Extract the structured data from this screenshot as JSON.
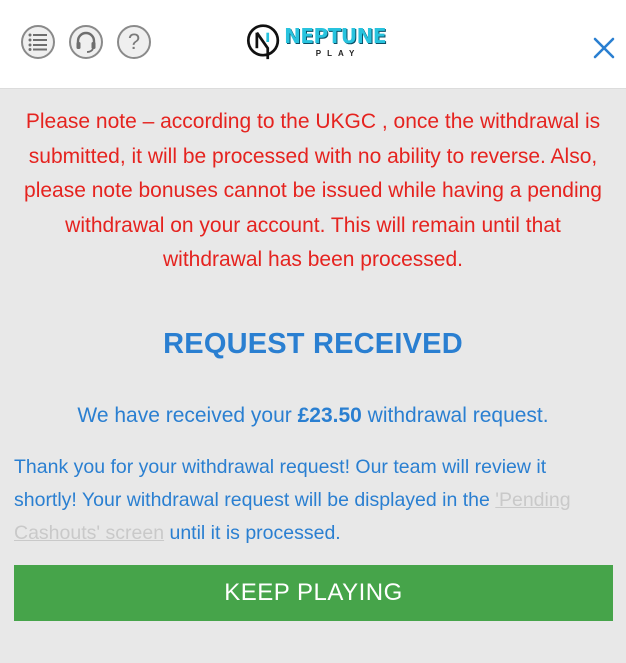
{
  "header": {
    "menu_icon": "list-icon",
    "support_icon": "headset-icon",
    "help_icon": "question-icon",
    "help_glyph": "?",
    "logo": {
      "name": "NEPTUNE",
      "sub": "PLAY"
    },
    "close_icon": "close-icon"
  },
  "notice": {
    "text": "Please note – according to the UKGC , once the withdrawal is submitted, it will be processed with no ability to reverse. Also, please note bonuses cannot be issued while having a pending withdrawal on your account. This will remain until that withdrawal has been processed."
  },
  "confirmation": {
    "title": "REQUEST RECEIVED",
    "received_prefix": "We have received your ",
    "amount": "£23.50",
    "received_suffix": " withdrawal request.",
    "thanks_text": "Thank you for your withdrawal request! Our team will review it shortly! Your withdrawal request will be displayed in the ",
    "pending_link": "'Pending Cashouts' screen",
    "thanks_suffix": " until it is processed."
  },
  "actions": {
    "keep_playing": "KEEP PLAYING"
  },
  "colors": {
    "notice": "#e5231f",
    "accent": "#2a7fd1",
    "button": "#46a44a",
    "background": "#e8e8e8",
    "logo": "#28c3de"
  }
}
